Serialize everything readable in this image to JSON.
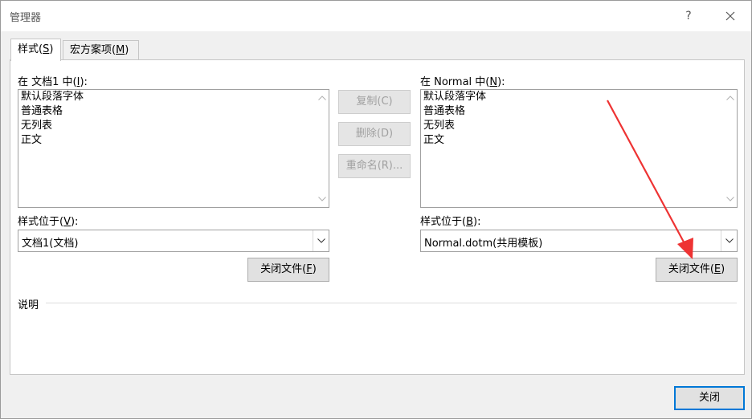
{
  "window": {
    "title": "管理器",
    "help": "?"
  },
  "tabs": [
    {
      "label_pre": "样式(",
      "key": "S",
      "label_post": ")"
    },
    {
      "label_pre": "宏方案项(",
      "key": "M",
      "label_post": ")"
    }
  ],
  "left": {
    "list_label_pre": "在 文档1 中(",
    "list_label_key": "I",
    "list_label_post": "):",
    "items": [
      "默认段落字体",
      "普通表格",
      "无列表",
      "正文"
    ],
    "location_label_pre": "样式位于(",
    "location_label_key": "V",
    "location_label_post": "):",
    "location_value": "文档1(文档)",
    "close_file_pre": "关闭文件(",
    "close_file_key": "F",
    "close_file_post": ")"
  },
  "middle": {
    "copy_label": "复制(C)",
    "delete_label": "删除(D)",
    "rename_label": "重命名(R)..."
  },
  "right": {
    "list_label_pre": "在 Normal 中(",
    "list_label_key": "N",
    "list_label_post": "):",
    "items": [
      "默认段落字体",
      "普通表格",
      "无列表",
      "正文"
    ],
    "location_label_pre": "样式位于(",
    "location_label_key": "B",
    "location_label_post": "):",
    "location_value": "Normal.dotm(共用模板)",
    "close_file_pre": "关闭文件(",
    "close_file_key": "E",
    "close_file_post": ")"
  },
  "description_label": "说明",
  "footer": {
    "close_label": "关闭"
  },
  "colors": {
    "annotation_arrow": "#ee3333",
    "accent": "#0078d7"
  }
}
